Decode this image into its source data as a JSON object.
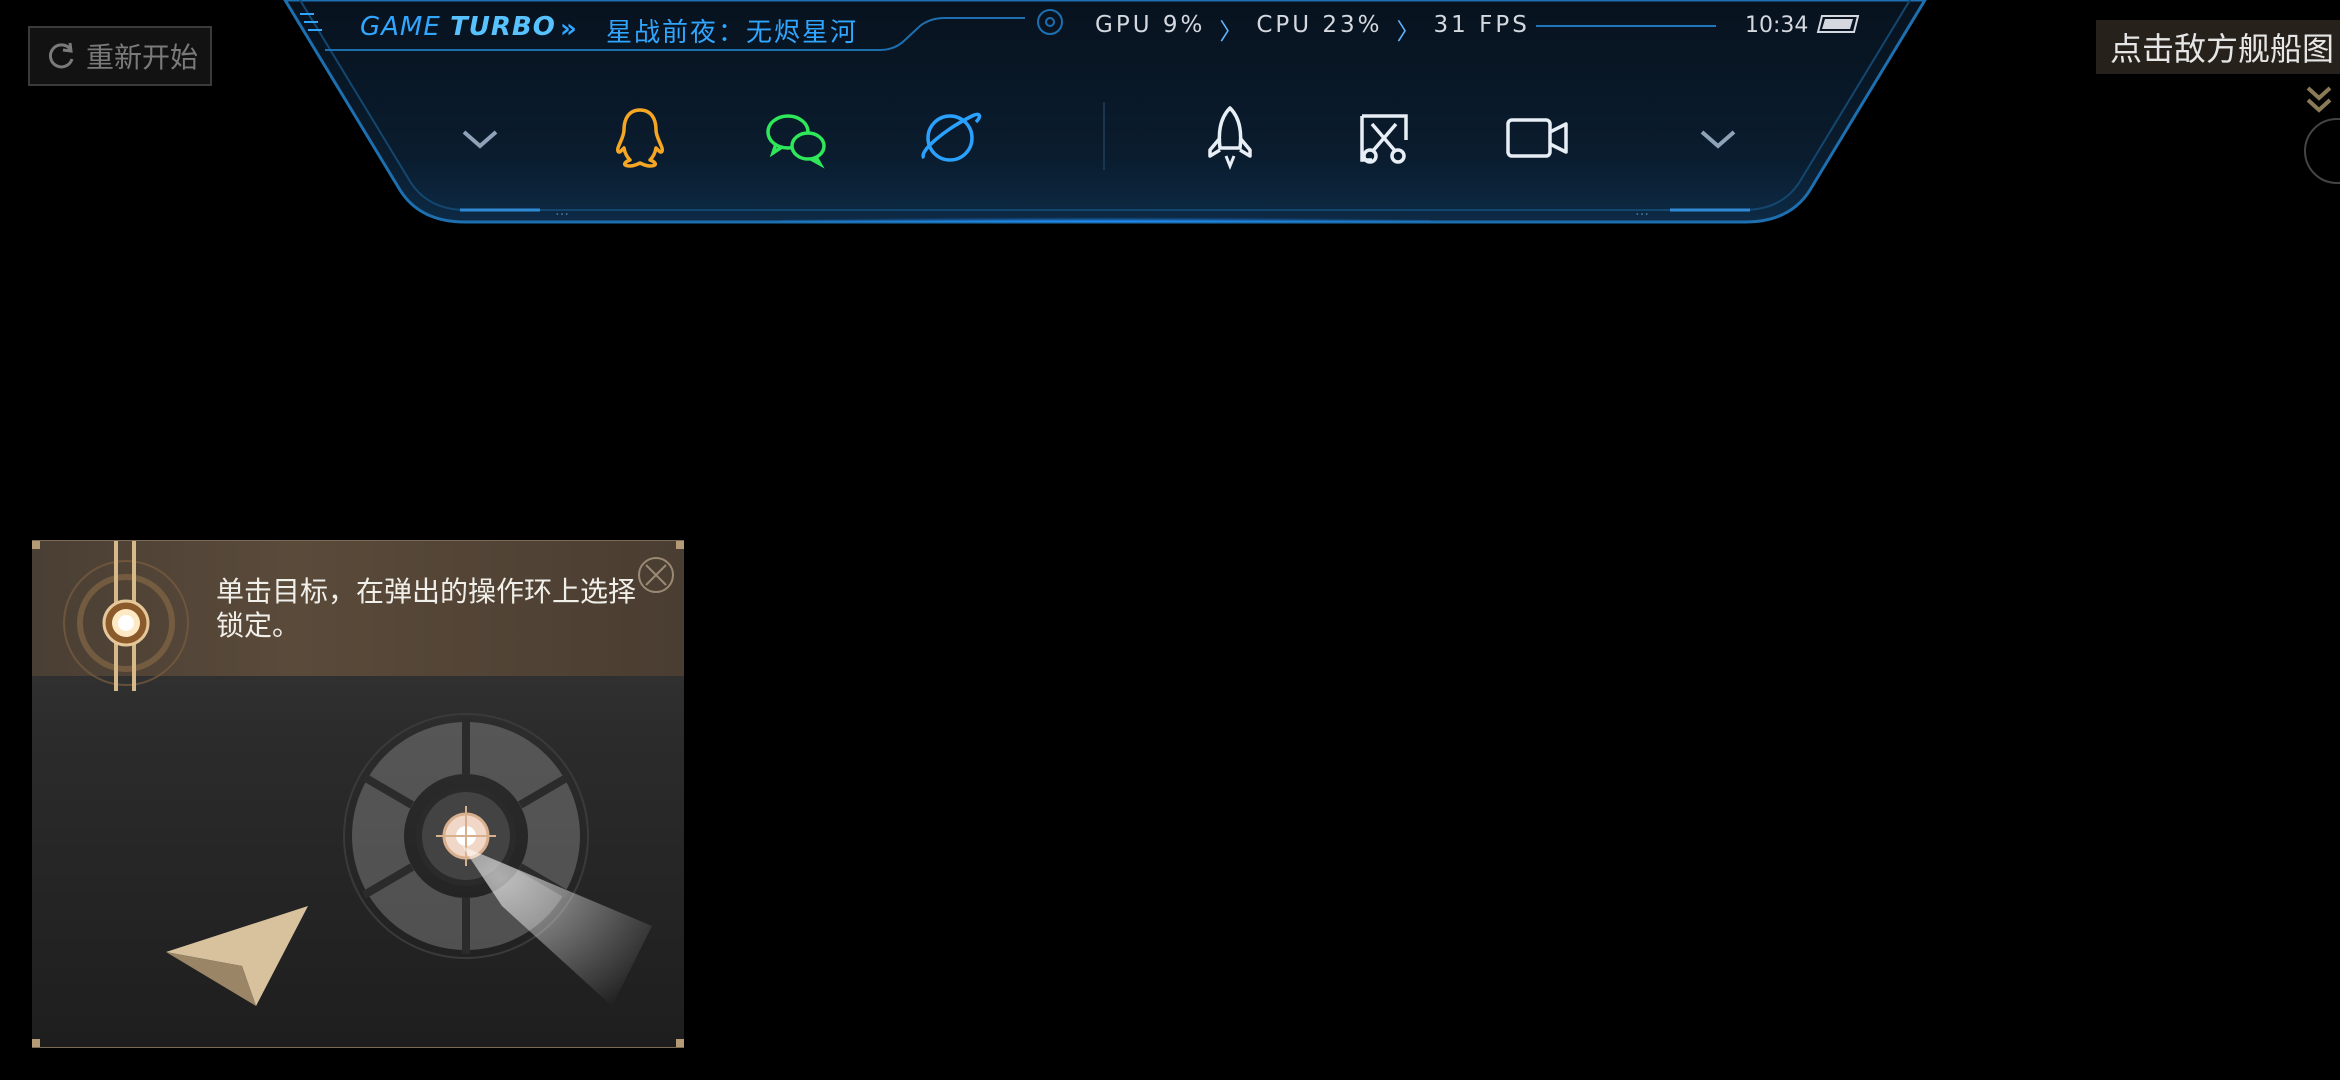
{
  "restart_button": {
    "label": "重新开始",
    "icon": "refresh-icon"
  },
  "enemy_hint": {
    "text": "点击敌方舰船图"
  },
  "turbo": {
    "brand_prefix": "GAME",
    "brand_suffix": "TURBO",
    "arrows": "»",
    "game_title": "星战前夜：无烬星河",
    "gpu": "GPU 9%",
    "cpu": "CPU 23%",
    "fps": "31 FPS",
    "time": "10:34",
    "accent": "#31a6ff",
    "icons_left": [
      "chevron-down-icon",
      "qq-icon",
      "wechat-icon",
      "planet-icon"
    ],
    "icons_right": [
      "rocket-icon",
      "scissors-screenshot-icon",
      "video-camera-icon",
      "chevron-down-icon"
    ]
  },
  "tutorial": {
    "text": "单击目标，在弹出的操作环上选择锁定。",
    "close_icon": "close-icon"
  }
}
